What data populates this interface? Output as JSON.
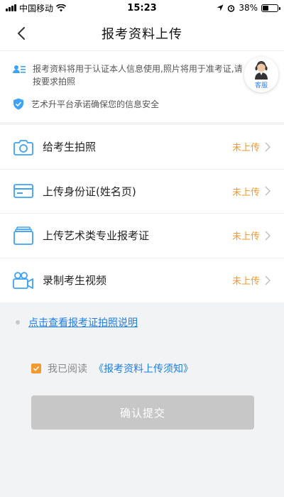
{
  "status_bar": {
    "carrier": "中国移动",
    "time": "15:23",
    "battery": "38%",
    "battery_level": 0.38
  },
  "nav": {
    "title": "报考资料上传",
    "back_icon": "chevron-left-icon"
  },
  "notice": {
    "info_text": "报考资料将用于认证本人信息使用,照片将用于准考证,请按要求拍照",
    "security_text": "艺术升平台承诺确保您的信息安全",
    "service_label": "客服"
  },
  "upload_items": [
    {
      "label": "给考生拍照",
      "status": "未上传",
      "icon": "camera-icon"
    },
    {
      "label": "上传身份证(姓名页)",
      "status": "未上传",
      "icon": "id-card-icon"
    },
    {
      "label": "上传艺术类专业报考证",
      "status": "未上传",
      "icon": "certificate-icon"
    },
    {
      "label": "录制考生视频",
      "status": "未上传",
      "icon": "video-camera-icon"
    }
  ],
  "guide_link": "点击查看报考证拍照说明",
  "agreement": {
    "prefix": "我已阅读",
    "link": "《报考资料上传须知》",
    "checked": true
  },
  "submit_label": "确认提交",
  "colors": {
    "accent_blue": "#1e7ee8",
    "status_orange": "#f19a30",
    "icon_blue": "#3ea2f5",
    "disabled_gray": "#c7c7c7"
  }
}
